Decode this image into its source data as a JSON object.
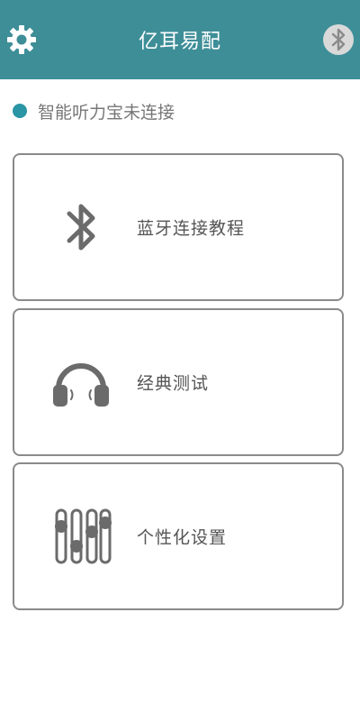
{
  "header": {
    "title": "亿耳易配",
    "settings_icon": "gear-icon",
    "bluetooth_icon": "bluetooth-icon"
  },
  "status": {
    "text": "智能听力宝未连接",
    "dot_color": "#2a95a5"
  },
  "menu": [
    {
      "label": "蓝牙连接教程",
      "icon": "bluetooth-icon"
    },
    {
      "label": "经典测试",
      "icon": "headphones-icon"
    },
    {
      "label": "个性化设置",
      "icon": "equalizer-icon"
    }
  ],
  "colors": {
    "header_bg": "#3e8e98",
    "card_border": "#8a8a8a",
    "icon_gray": "#6b6b6b"
  }
}
